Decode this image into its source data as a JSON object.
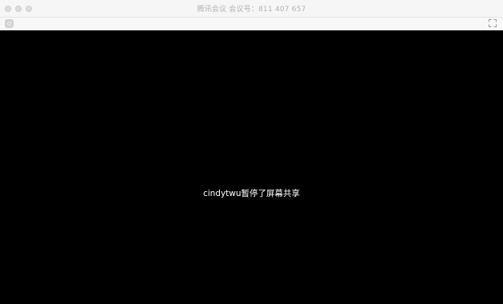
{
  "window": {
    "title": "腾讯会议 会议号：811 407 657"
  },
  "icons": {
    "app": "gear-icon",
    "fullscreen": "fullscreen-icon"
  },
  "share": {
    "message": "cindytwu暂停了屏幕共享"
  },
  "colors": {
    "titlebar_bg": "#f6f6f6",
    "content_bg": "#000000",
    "message_text": "#ffffff"
  }
}
